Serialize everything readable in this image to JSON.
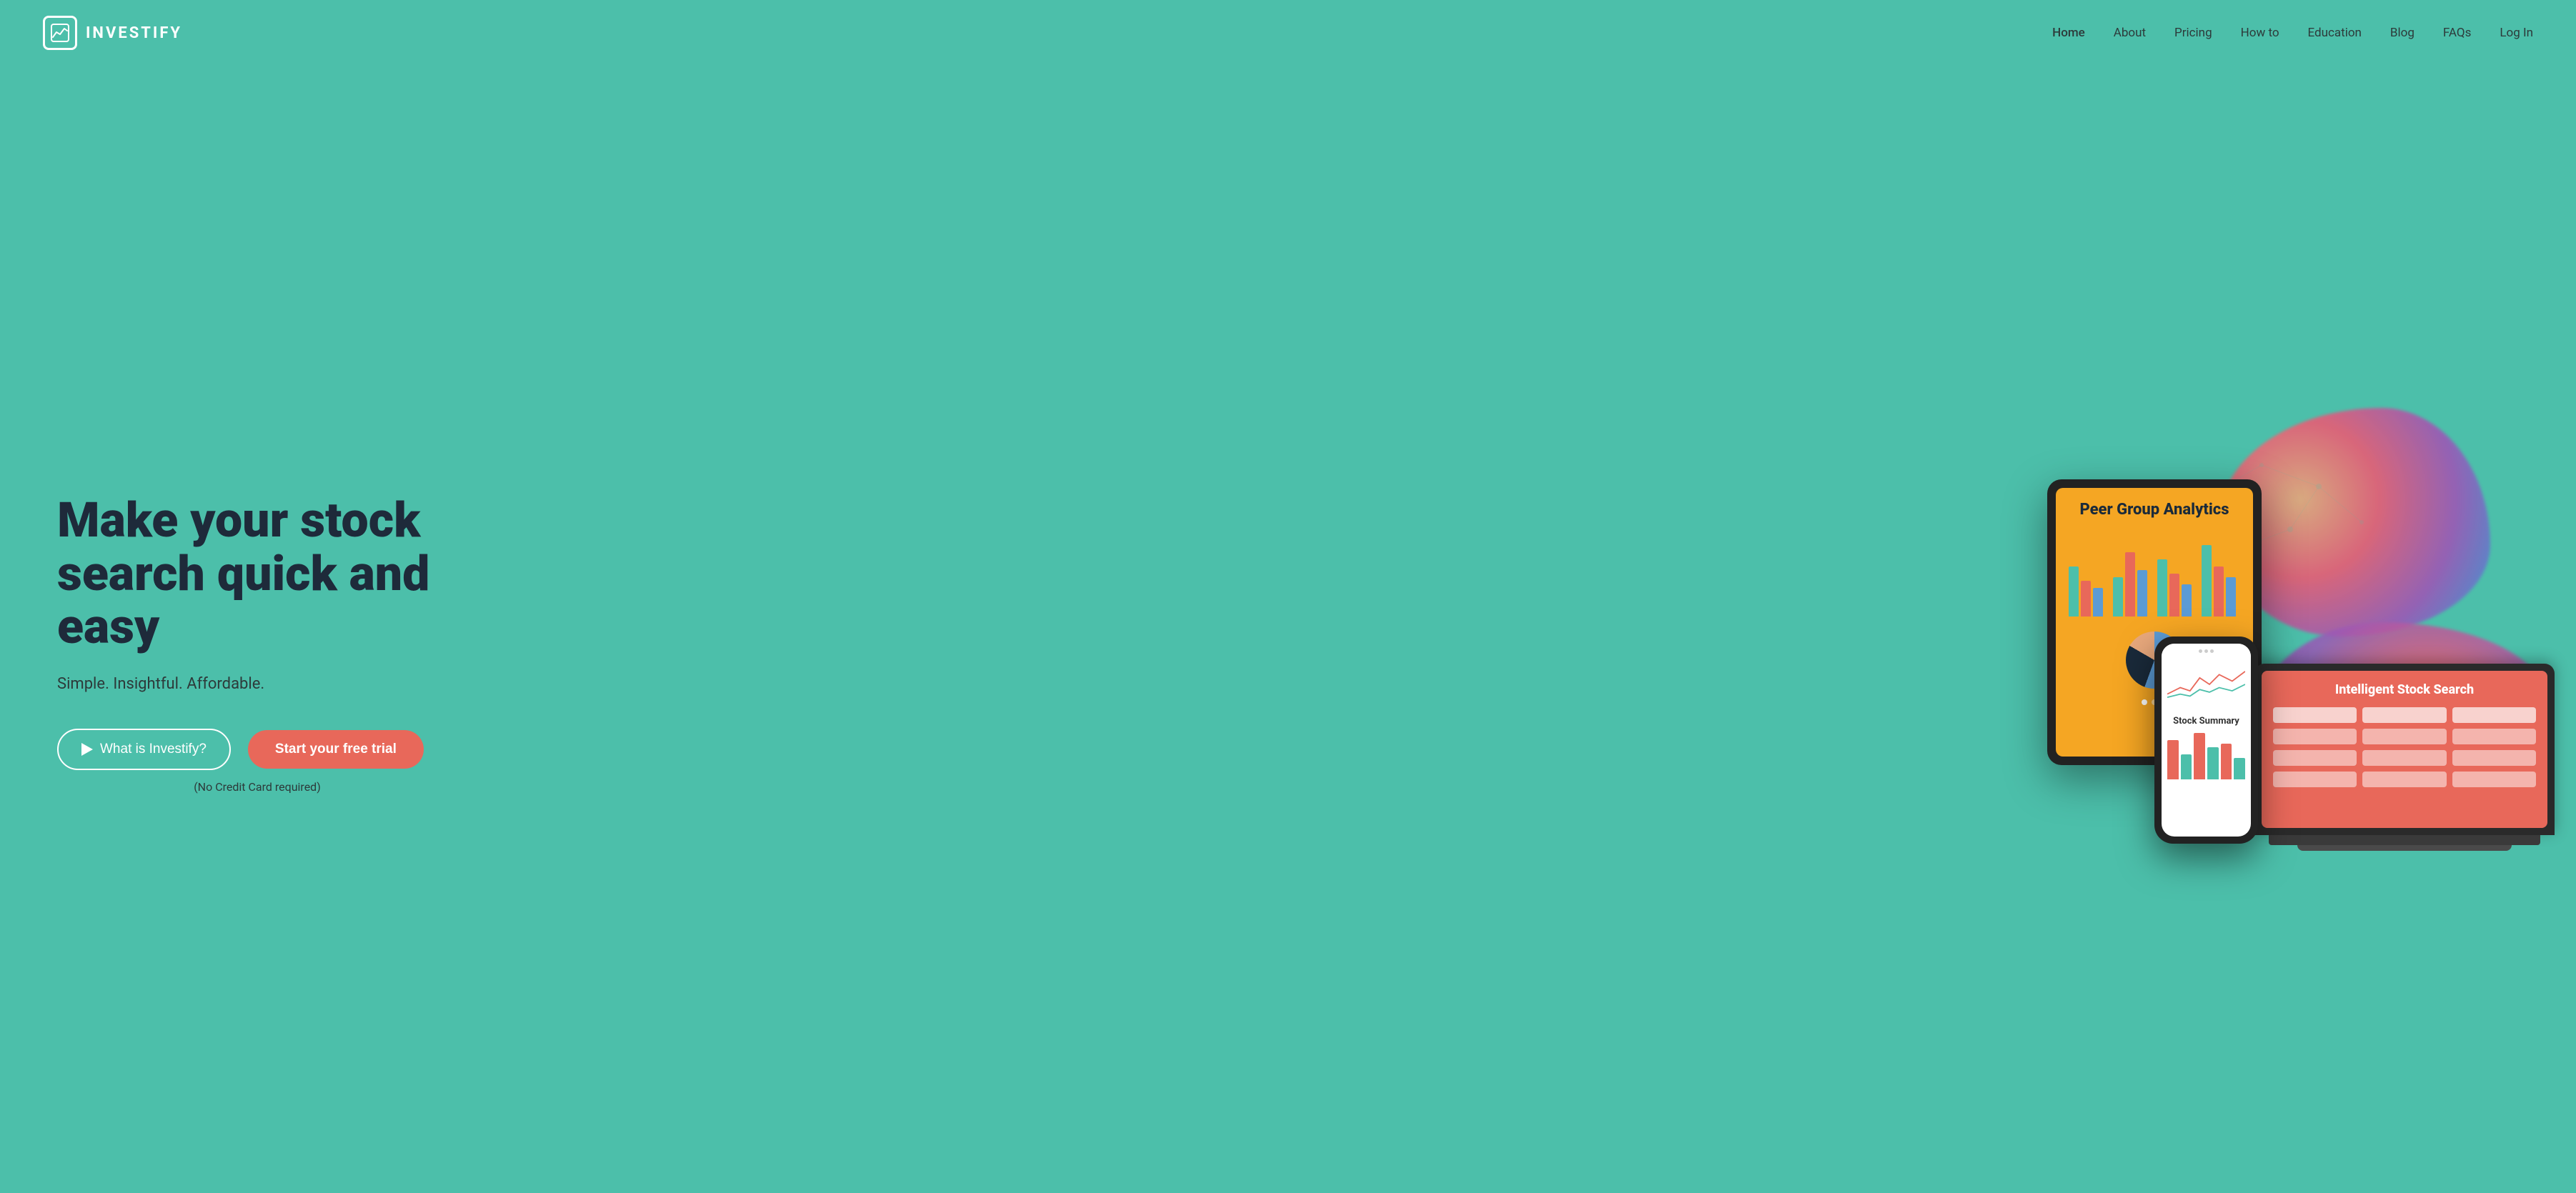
{
  "brand": {
    "name": "INVESTIFY",
    "logo_alt": "Investify logo icon"
  },
  "nav": {
    "links": [
      {
        "label": "Home",
        "active": true
      },
      {
        "label": "About",
        "active": false
      },
      {
        "label": "Pricing",
        "active": false
      },
      {
        "label": "How to",
        "active": false
      },
      {
        "label": "Education",
        "active": false
      },
      {
        "label": "Blog",
        "active": false
      },
      {
        "label": "FAQs",
        "active": false
      },
      {
        "label": "Log In",
        "active": false
      }
    ]
  },
  "hero": {
    "headline": "Make your stock search quick and easy",
    "subtext": "Simple. Insightful. Affordable.",
    "btn_outline": "What is Investify?",
    "btn_primary": "Start your free trial",
    "no_credit": "(No Credit Card required)"
  },
  "tablet": {
    "title": "Peer Group Analytics"
  },
  "phone": {
    "title": "Stock Summary"
  },
  "laptop": {
    "title": "Intelligent Stock Search"
  },
  "colors": {
    "bg": "#4cbfaa",
    "headline": "#1e2a3a",
    "btn_primary": "#e8685a",
    "laptop_bg": "#e8685a"
  }
}
